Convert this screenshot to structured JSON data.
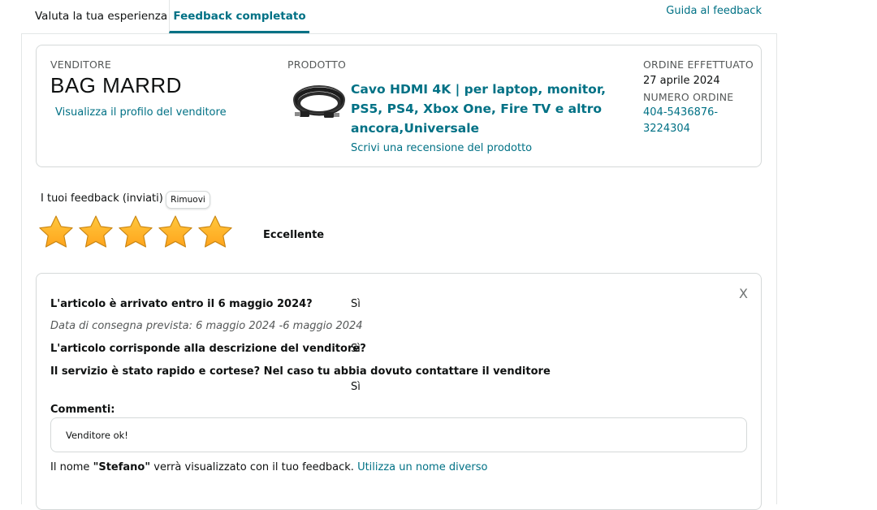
{
  "tabs": {
    "rate": "Valuta la tua esperienza",
    "completed": "Feedback completato"
  },
  "guide_link": "Guida al feedback",
  "seller": {
    "label": "VENDITORE",
    "name": "BAG MARRD",
    "profile_link": "Visualizza il profilo del venditore"
  },
  "product": {
    "label": "PRODOTTO",
    "title": "Cavo HDMI 4K | per laptop, monitor, PS5, PS4, Xbox One, Fire TV e altro ancora,Universale",
    "review_link": "Scrivi una recensione del prodotto",
    "image_icon": "hdmi-cable-image"
  },
  "order": {
    "placed_label": "ORDINE EFFETTUATO",
    "placed_date": "27 aprile 2024",
    "number_label": "NUMERO ORDINE",
    "number_value": "404-5436876-3224304"
  },
  "feedback": {
    "label": "I tuoi feedback (inviati)",
    "remove_button": "Rimuovi",
    "rating": 5,
    "rating_max": 5,
    "rating_text": "Eccellente",
    "star_color": "#ffa41c"
  },
  "details": {
    "close_label": "X",
    "q1": "L'articolo è arrivato entro il 6 maggio 2024?",
    "a1": "Sì",
    "delivery_note": "Data di consegna prevista: 6 maggio 2024 -6 maggio 2024",
    "q2": "L'articolo corrisponde alla descrizione del venditore?",
    "a2": "Sì",
    "q3": "Il servizio è stato rapido e cortese? Nel caso tu abbia dovuto contattare il venditore",
    "a3": "Sì",
    "comments_label": "Commenti:",
    "comment": "Venditore ok!",
    "name_prefix": "Il nome ",
    "name_value": "\"Stefano\"",
    "name_suffix": " verrà visualizzato con il tuo feedback. ",
    "name_link": "Utilizza un nome diverso"
  },
  "colors": {
    "link": "#007185",
    "border": "#d5d9d9"
  }
}
